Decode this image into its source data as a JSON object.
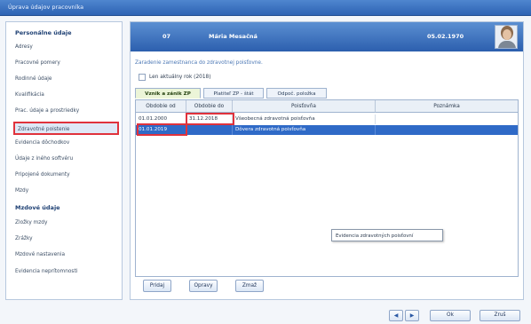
{
  "window": {
    "title": "Úprava údajov pracovníka"
  },
  "sidebar": {
    "section1": "Personálne údaje",
    "items1": [
      "Adresy",
      "Pracovné pomery",
      "Rodinné údaje",
      "Kvalifikácia",
      "Prac. údaje a prostriedky",
      "Zdravotné poistenie",
      "Evidencia dôchodkov",
      "Údaje z iného softvéru",
      "Pripojené dokumenty",
      "Mzdy"
    ],
    "active_item": "Zdravotné poistenie",
    "section2": "Mzdové údaje",
    "items2": [
      "Zložky mzdy",
      "Zrážky",
      "Mzdové nastavenia",
      "Evidencia neprítomnosti"
    ]
  },
  "employee": {
    "number": "07",
    "name": "Mária Mesačná",
    "birth_date": "05.02.1970"
  },
  "main": {
    "headline": "Zaradenie zamestnanca do zdravotnej poisťovne.",
    "checkbox_label": "Len aktuálny rok (2018)",
    "checkbox_checked": false,
    "tabs": [
      "Vznik a zánik ZP",
      "Platiteľ ZP - štát",
      "Odpoč. položka"
    ],
    "active_tab": "Vznik a zánik ZP"
  },
  "table": {
    "columns": [
      "Obdobie od",
      "Obdobie do",
      "Poisťovňa",
      "Poznámka"
    ],
    "rows": [
      {
        "from": "01.01.2000",
        "to": "31.12.2018",
        "insurer": "Všeobecná zdravotná poisťovňa",
        "note": ""
      },
      {
        "from": "01.01.2019",
        "to": "",
        "insurer": "Dôvera zdravotná poisťovňa",
        "note": ""
      }
    ],
    "selected_row": 1
  },
  "tooltip": {
    "text": "Evidencia zdravotných poisťovní"
  },
  "buttons": {
    "add": "Pridaj",
    "edit": "Opravy",
    "delete": "Zmaž",
    "ok": "Ok",
    "cancel": "Zruš"
  },
  "nav": {
    "prev_glyph": "◀",
    "next_glyph": "▶"
  },
  "colors": {
    "accent": "#2f6ac7",
    "highlight": "#e0323c",
    "active_tab": "#ecf5d8"
  }
}
